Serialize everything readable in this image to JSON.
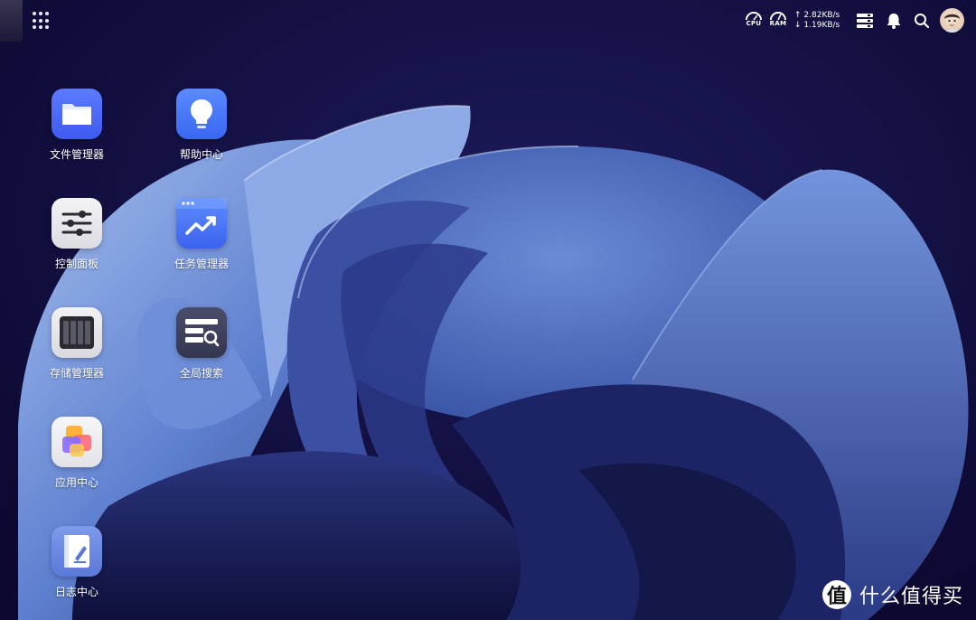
{
  "topbar": {
    "cpu_label": "CPU",
    "ram_label": "RAM",
    "upload_speed": "↑ 2.82KB/s",
    "download_speed": "↓ 1.19KB/s",
    "icons": [
      "launcher-grid-icon",
      "cpu-gauge-icon",
      "ram-gauge-icon",
      "storage-status-icon",
      "bell-icon",
      "search-icon",
      "avatar"
    ]
  },
  "apps": [
    {
      "label": "文件管理器",
      "icon": "folder-icon"
    },
    {
      "label": "帮助中心",
      "icon": "lightbulb-icon"
    },
    {
      "label": "控制面板",
      "icon": "sliders-icon"
    },
    {
      "label": "任务管理器",
      "icon": "trend-chart-icon"
    },
    {
      "label": "存储管理器",
      "icon": "disk-bays-icon"
    },
    {
      "label": "全局搜索",
      "icon": "search-list-icon"
    },
    {
      "label": "应用中心",
      "icon": "app-stack-icon"
    },
    {
      "label": "日志中心",
      "icon": "log-book-icon"
    }
  ],
  "watermark": {
    "glyph": "值",
    "text": "什么值得买"
  },
  "colors": {
    "background": "#0f0a33",
    "wallpaper_blue": "#5a78c4",
    "text": "#ffffff"
  }
}
